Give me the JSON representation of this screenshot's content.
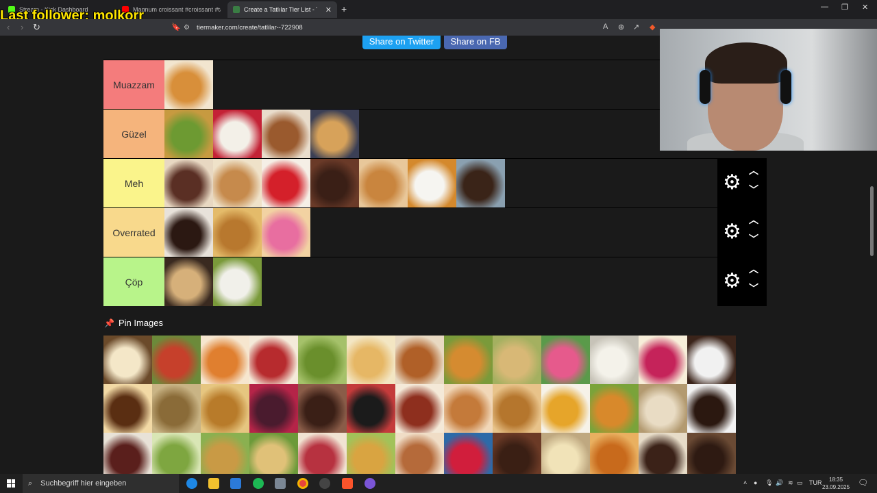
{
  "tabs": [
    {
      "title": "Stream - Kick Dashboard",
      "color": "#53fc18"
    },
    {
      "title": "Magnum croissant #croissant #tasteit",
      "color": "#ff0000"
    },
    {
      "title": "Create a Tatlılar Tier List - TierMaker",
      "color": "#3a7d44"
    }
  ],
  "overlay": {
    "follower": "Last follower: molkorr"
  },
  "address": {
    "url": "tiermaker.com/create/tatlilar--722908"
  },
  "share": {
    "twitter": "Share on Twitter",
    "facebook": "Share on FB"
  },
  "tiers": [
    {
      "label": "Muazzam",
      "color": "#f47c7c",
      "items": [
        "croissant"
      ]
    },
    {
      "label": "Güzel",
      "color": "#f5b47c",
      "items": [
        "baklava",
        "cheesecake",
        "leaf-cookies",
        "kunefe-bowl"
      ]
    },
    {
      "label": "Meh",
      "color": "#faf48b",
      "items": [
        "ice-cream-cake",
        "apple-pie",
        "red-velvet",
        "brownie",
        "strudel",
        "creme-brulee",
        "eclairs"
      ]
    },
    {
      "label": "Overrated",
      "color": "#f8d98c",
      "items": [
        "chocolate-donut",
        "walnut-baklava",
        "sprinkle-donuts"
      ]
    },
    {
      "label": "Çöp",
      "color": "#b8f48a",
      "items": [
        "cannoli",
        "coconut-dessert"
      ]
    }
  ],
  "pin_images": {
    "title": "Pin Images",
    "items": [
      {
        "name": "japanese-cheesecake",
        "colors": [
          "#f4e7c8",
          "#6b4a2a"
        ]
      },
      {
        "name": "tomato-dessert",
        "colors": [
          "#c6402b",
          "#6c8a3a"
        ]
      },
      {
        "name": "sekerpare",
        "colors": [
          "#e07f2f",
          "#f6e6cf"
        ]
      },
      {
        "name": "red-velvet-slice",
        "colors": [
          "#b72b2e",
          "#f4ead9"
        ]
      },
      {
        "name": "pistachio-cake",
        "colors": [
          "#6a8f2c",
          "#a5c16a"
        ]
      },
      {
        "name": "revani",
        "colors": [
          "#e6b765",
          "#f3e6c3"
        ]
      },
      {
        "name": "churros",
        "colors": [
          "#b06028",
          "#e8d9c2"
        ]
      },
      {
        "name": "kunefe",
        "colors": [
          "#d58b30",
          "#7a9a3a"
        ]
      },
      {
        "name": "semolina-squares",
        "colors": [
          "#d8b876",
          "#a4b060"
        ]
      },
      {
        "name": "macarons",
        "colors": [
          "#e65a8c",
          "#5a9a4a"
        ]
      },
      {
        "name": "cream-dessert",
        "colors": [
          "#f4f2ea",
          "#c7c3b8"
        ]
      },
      {
        "name": "raspberry-cheesecake",
        "colors": [
          "#c5235a",
          "#f7eed9"
        ]
      },
      {
        "name": "profiteroles",
        "colors": [
          "#f1f1f1",
          "#3b241a"
        ]
      },
      {
        "name": "basque-cheesecake",
        "colors": [
          "#5a2e12",
          "#f2d9a5"
        ]
      },
      {
        "name": "tiramisu-tray",
        "colors": [
          "#8a6b38",
          "#c9b485"
        ]
      },
      {
        "name": "sutlac",
        "colors": [
          "#b87b2a",
          "#e6c680"
        ]
      },
      {
        "name": "berry-tart",
        "colors": [
          "#4a1b2e",
          "#b52448"
        ]
      },
      {
        "name": "chocolate-layer",
        "colors": [
          "#3a1f16",
          "#8a5c48"
        ]
      },
      {
        "name": "trifle-glass",
        "colors": [
          "#1b1b1b",
          "#c43b3b"
        ]
      },
      {
        "name": "trilece",
        "colors": [
          "#8e2f1e",
          "#f4e9d8"
        ]
      },
      {
        "name": "madeleines",
        "colors": [
          "#c47a3a",
          "#f1d7b8"
        ]
      },
      {
        "name": "waffle",
        "colors": [
          "#b5762d",
          "#e8c38a"
        ]
      },
      {
        "name": "flan",
        "colors": [
          "#e6a52a",
          "#f6f2e8"
        ]
      },
      {
        "name": "kadayif",
        "colors": [
          "#d8892b",
          "#7aa33a"
        ]
      },
      {
        "name": "cookie-rolls",
        "colors": [
          "#e9dcc4",
          "#b39a70"
        ]
      },
      {
        "name": "lava-cake",
        "colors": [
          "#2b1810",
          "#f2f2f2"
        ]
      },
      {
        "name": "chocolate-roll",
        "colors": [
          "#5a1f1c",
          "#e8e2d7"
        ]
      },
      {
        "name": "green-bars",
        "colors": [
          "#7ea640",
          "#d9e6b5"
        ]
      },
      {
        "name": "baklava-plate",
        "colors": [
          "#c99a45",
          "#8ab050"
        ]
      },
      {
        "name": "sobiyet",
        "colors": [
          "#e0c178",
          "#6c9a3a"
        ]
      },
      {
        "name": "berry-bowl",
        "colors": [
          "#b73240",
          "#f1e3d2"
        ]
      },
      {
        "name": "kunefe-slice",
        "colors": [
          "#d9a441",
          "#a2c259"
        ]
      },
      {
        "name": "cake-roll",
        "colors": [
          "#b56a3a",
          "#f0ddc6"
        ]
      },
      {
        "name": "strawberry-sundae",
        "colors": [
          "#d11e3c",
          "#2d6aa8"
        ]
      },
      {
        "name": "chocolate-muffin",
        "colors": [
          "#3a1f14",
          "#6b3a26"
        ]
      },
      {
        "name": "pudding-cup",
        "colors": [
          "#f1e3b8",
          "#bfa880"
        ]
      },
      {
        "name": "lokma",
        "colors": [
          "#c86a1c",
          "#e9b060"
        ]
      },
      {
        "name": "mosaic-cake",
        "colors": [
          "#3b2218",
          "#e7dcc8"
        ]
      },
      {
        "name": "salami-chocolate",
        "colors": [
          "#2e1a12",
          "#6a4a34"
        ]
      }
    ]
  },
  "item_colors": {
    "croissant": [
      "#d88f3a",
      "#f2e5cf"
    ],
    "baklava": [
      "#6d9a32",
      "#c79a40"
    ],
    "cheesecake": [
      "#f3f0e8",
      "#c42236"
    ],
    "leaf-cookies": [
      "#9a5a2e",
      "#e9ddcc"
    ],
    "kunefe-bowl": [
      "#d7a25a",
      "#3b3f55"
    ],
    "ice-cream-cake": [
      "#5a2f24",
      "#e8d8c2"
    ],
    "apple-pie": [
      "#c68a4c",
      "#efe2c9"
    ],
    "red-velvet": [
      "#d4202a",
      "#f5efe6"
    ],
    "brownie": [
      "#3a1f16",
      "#6a3a28"
    ],
    "strudel": [
      "#c9853e",
      "#e8c79a"
    ],
    "creme-brulee": [
      "#f6f5f1",
      "#d4892d"
    ],
    "eclairs": [
      "#3a2418",
      "#8aa0b0"
    ],
    "chocolate-donut": [
      "#2b1812",
      "#e8e2da"
    ],
    "walnut-baklava": [
      "#b8782e",
      "#e4bb6a"
    ],
    "sprinkle-donuts": [
      "#e86ea0",
      "#f2d2a2"
    ],
    "cannoli": [
      "#d6b07a",
      "#3a2a20"
    ],
    "coconut-dessert": [
      "#f1f0ea",
      "#7a9a3a"
    ]
  },
  "controls": {
    "gear": "⚙",
    "up": "⌃",
    "down": "⌄"
  },
  "taskbar": {
    "search_placeholder": "Suchbegriff hier eingeben",
    "lang": "TUR",
    "time": "18:35",
    "date": "23.09.2025"
  }
}
